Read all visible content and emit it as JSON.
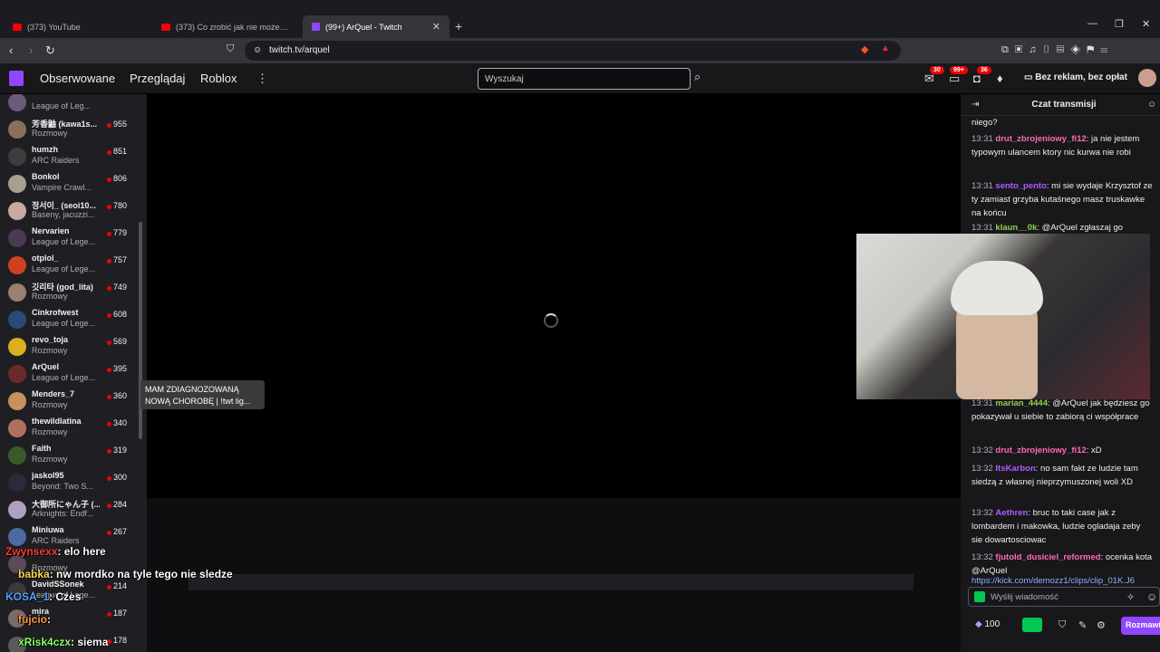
{
  "browser": {
    "tabs": [
      {
        "label": "(373) YouTube",
        "kind": "youtube"
      },
      {
        "label": "(373) Co zrobić jak nie możesz trenować",
        "kind": "youtube"
      },
      {
        "label": "(99+) ArQuel - Twitch",
        "kind": "twitch"
      }
    ],
    "new_tab": "+",
    "url": "twitch.tv/arquel"
  },
  "twitch": {
    "nav": [
      "Obserwowane",
      "Przeglądaj",
      "Roblox"
    ],
    "search_placeholder": "Wyszukaj",
    "badges": [
      "30",
      "99+",
      "36"
    ],
    "no_ads": "Bez reklam, bez opłat"
  },
  "sidebar": {
    "channels": [
      {
        "name": "",
        "game": "League of Leg...",
        "viewers": "",
        "color": "#6b5a7a"
      },
      {
        "name": "芳香鼬 (kawa1s...",
        "game": "Rozmowy",
        "viewers": "955",
        "color": "#8a6f5c"
      },
      {
        "name": "humzh",
        "game": "ARC Raiders",
        "viewers": "851",
        "color": "#3d3d3d"
      },
      {
        "name": "Bonkol",
        "game": "Vampire Crawl...",
        "viewers": "806",
        "color": "#a7a090"
      },
      {
        "name": "정서이_ (seoi10...",
        "game": "Baseny, jacuzzi...",
        "viewers": "780",
        "color": "#caa9a0"
      },
      {
        "name": "Nervarien",
        "game": "League of Lege...",
        "viewers": "779",
        "color": "#4a3a52"
      },
      {
        "name": "otplol_",
        "game": "League of Lege...",
        "viewers": "757",
        "color": "#d04020"
      },
      {
        "name": "깃리타 (god_lita)",
        "game": "Rozmowy",
        "viewers": "749",
        "color": "#9a8070"
      },
      {
        "name": "Cinkrofwest",
        "game": "League of Lege...",
        "viewers": "608",
        "color": "#2a4a7a"
      },
      {
        "name": "revo_toja",
        "game": "Rozmowy",
        "viewers": "569",
        "color": "#d8b020"
      },
      {
        "name": "ArQuel",
        "game": "League of Lege...",
        "viewers": "395",
        "color": "#6a2a2a"
      },
      {
        "name": "Menders_7",
        "game": "Rozmowy",
        "viewers": "360",
        "color": "#c89060"
      },
      {
        "name": "thewildlatina",
        "game": "Rozmowy",
        "viewers": "340",
        "color": "#b07060"
      },
      {
        "name": "Faith",
        "game": "Rozmowy",
        "viewers": "319",
        "color": "#3a5a2a"
      },
      {
        "name": "jaskol95",
        "game": "Beyond: Two S...",
        "viewers": "300",
        "color": "#2a2a3a"
      },
      {
        "name": "大御所にゃん子 (...",
        "game": "Arknights: Endf...",
        "viewers": "284",
        "color": "#b0a0c0"
      },
      {
        "name": "Miniuwa",
        "game": "ARC Raiders",
        "viewers": "267",
        "color": "#4a6aa0"
      },
      {
        "name": "",
        "game": "Rozmowy",
        "viewers": "",
        "color": "#5a4a5a"
      },
      {
        "name": "DavidSSonek",
        "game": "League of Lege...",
        "viewers": "214",
        "color": "#3a3a3a"
      },
      {
        "name": "mira",
        "game": "",
        "viewers": "187",
        "color": "#7a6a6a"
      },
      {
        "name": "",
        "game": "",
        "viewers": "178",
        "color": "#5a5a5a"
      }
    ],
    "tooltip": "MAM ZDIAGNOZOWANĄ NOWĄ CHOROBĘ | !twt lig..."
  },
  "chat": {
    "title": "Czat transmisji",
    "messages": [
      {
        "time": "",
        "user": "",
        "color": "#efeff1",
        "text": "niego?"
      },
      {
        "time": "13:31",
        "user": "drut_zbrojeniowy_fi12",
        "color": "#ff69b4",
        "text": ": ja nie jestem typowym ulancem ktory nic kurwa nie robi"
      },
      {
        "time": "13:31",
        "user": "sento_pento",
        "color": "#b05aff",
        "text": ": mi sie wydaje Krzysztof ze ty zamiast grzyba kutaśnego masz truskawke na końcu"
      },
      {
        "time": "13:31",
        "user": "klaun__0k",
        "color": "#8fd14f",
        "text": ": @ArQuel zgłaszaj go"
      },
      {
        "time": "13:31",
        "user": "marian_4444",
        "color": "#8fd14f",
        "text": ": @ArQuel jak będziesz go pokazywał u siebie to zabiorą ci współprace"
      },
      {
        "time": "13:32",
        "user": "drut_zbrojeniowy_fi12",
        "color": "#ff69b4",
        "text": ": xD"
      },
      {
        "time": "13:32",
        "user": "ItsKarbon",
        "color": "#b05aff",
        "text": ": no sam fakt ze ludzie tam siedzą z własnej nieprzymuszonej woli XD"
      },
      {
        "time": "13:32",
        "user": "Aethren",
        "color": "#b05aff",
        "text": ": bruc to taki case jak z lombardem i makowka, ludzie ogladaja zeby sie dowartosciowac"
      },
      {
        "time": "13:32",
        "user": "fjutold_dusiciel_reformed",
        "color": "#ff69b4",
        "text": ": ocenka kota @ArQuel"
      },
      {
        "time": "",
        "user": "",
        "color": "#8fb0ff",
        "text": "https://kick.com/demozz1/clips/clip_01K.J6"
      }
    ],
    "input_placeholder": "Wyślij wiadomość",
    "points": "100",
    "chat_button": "Rozmawiaj"
  },
  "overlay": {
    "messages": [
      {
        "user": "Zwynsexx",
        "text": ": elo here",
        "color": "#ff3b3b"
      },
      {
        "user": "babka",
        "text": ": nw mordko na tyle tego nie sledze",
        "color": "#ffd84a"
      },
      {
        "user": "KOSA_1",
        "text": ": Czes",
        "color": "#5aa0ff"
      },
      {
        "user": "fujcio",
        "text": ":",
        "color": "#ff9a3a"
      },
      {
        "user": "xRisk4czx",
        "text": ": siema",
        "color": "#8aff6a"
      }
    ]
  }
}
